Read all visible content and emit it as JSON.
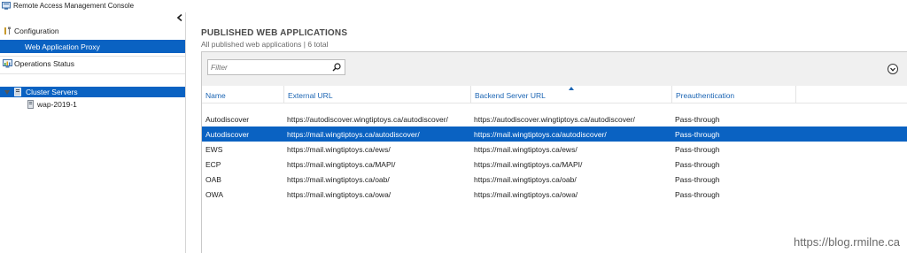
{
  "window": {
    "title": "Remote Access Management Console"
  },
  "nav": {
    "configuration_label": "Configuration",
    "web_app_proxy_label": "Web Application Proxy",
    "operations_status_label": "Operations Status",
    "cluster_servers_label": "Cluster Servers",
    "server_label": "wap-2019-1"
  },
  "main": {
    "heading": "PUBLISHED WEB APPLICATIONS",
    "subheading": "All published web applications | 6 total",
    "filter_placeholder": "Filter",
    "columns": [
      "Name",
      "External URL",
      "Backend Server URL",
      "Preauthentication"
    ],
    "rows": [
      {
        "name": "Autodiscover",
        "external_url": "https://autodiscover.wingtiptoys.ca/autodiscover/",
        "backend_url": "https://autodiscover.wingtiptoys.ca/autodiscover/",
        "preauth": "Pass-through",
        "selected": false
      },
      {
        "name": "Autodiscover",
        "external_url": "https://mail.wingtiptoys.ca/autodiscover/",
        "backend_url": "https://mail.wingtiptoys.ca/autodiscover/",
        "preauth": "Pass-through",
        "selected": true
      },
      {
        "name": "EWS",
        "external_url": "https://mail.wingtiptoys.ca/ews/",
        "backend_url": "https://mail.wingtiptoys.ca/ews/",
        "preauth": "Pass-through",
        "selected": false
      },
      {
        "name": "ECP",
        "external_url": "https://mail.wingtiptoys.ca/MAPI/",
        "backend_url": "https://mail.wingtiptoys.ca/MAPI/",
        "preauth": "Pass-through",
        "selected": false
      },
      {
        "name": "OAB",
        "external_url": "https://mail.wingtiptoys.ca/oab/",
        "backend_url": "https://mail.wingtiptoys.ca/oab/",
        "preauth": "Pass-through",
        "selected": false
      },
      {
        "name": "OWA",
        "external_url": "https://mail.wingtiptoys.ca/owa/",
        "backend_url": "https://mail.wingtiptoys.ca/owa/",
        "preauth": "Pass-through",
        "selected": false
      }
    ]
  },
  "watermark": "https://blog.rmilne.ca",
  "colors": {
    "selection": "#0a62c2",
    "header_link": "#1a64b3"
  },
  "icons": {
    "app": "console-icon",
    "configuration": "tools-icon",
    "operations": "monitor-chart-icon",
    "cluster": "server-cluster-icon",
    "server": "server-icon",
    "filter": "search-icon",
    "expand": "chevron-down-icon",
    "collapse": "chevron-left-icon"
  }
}
